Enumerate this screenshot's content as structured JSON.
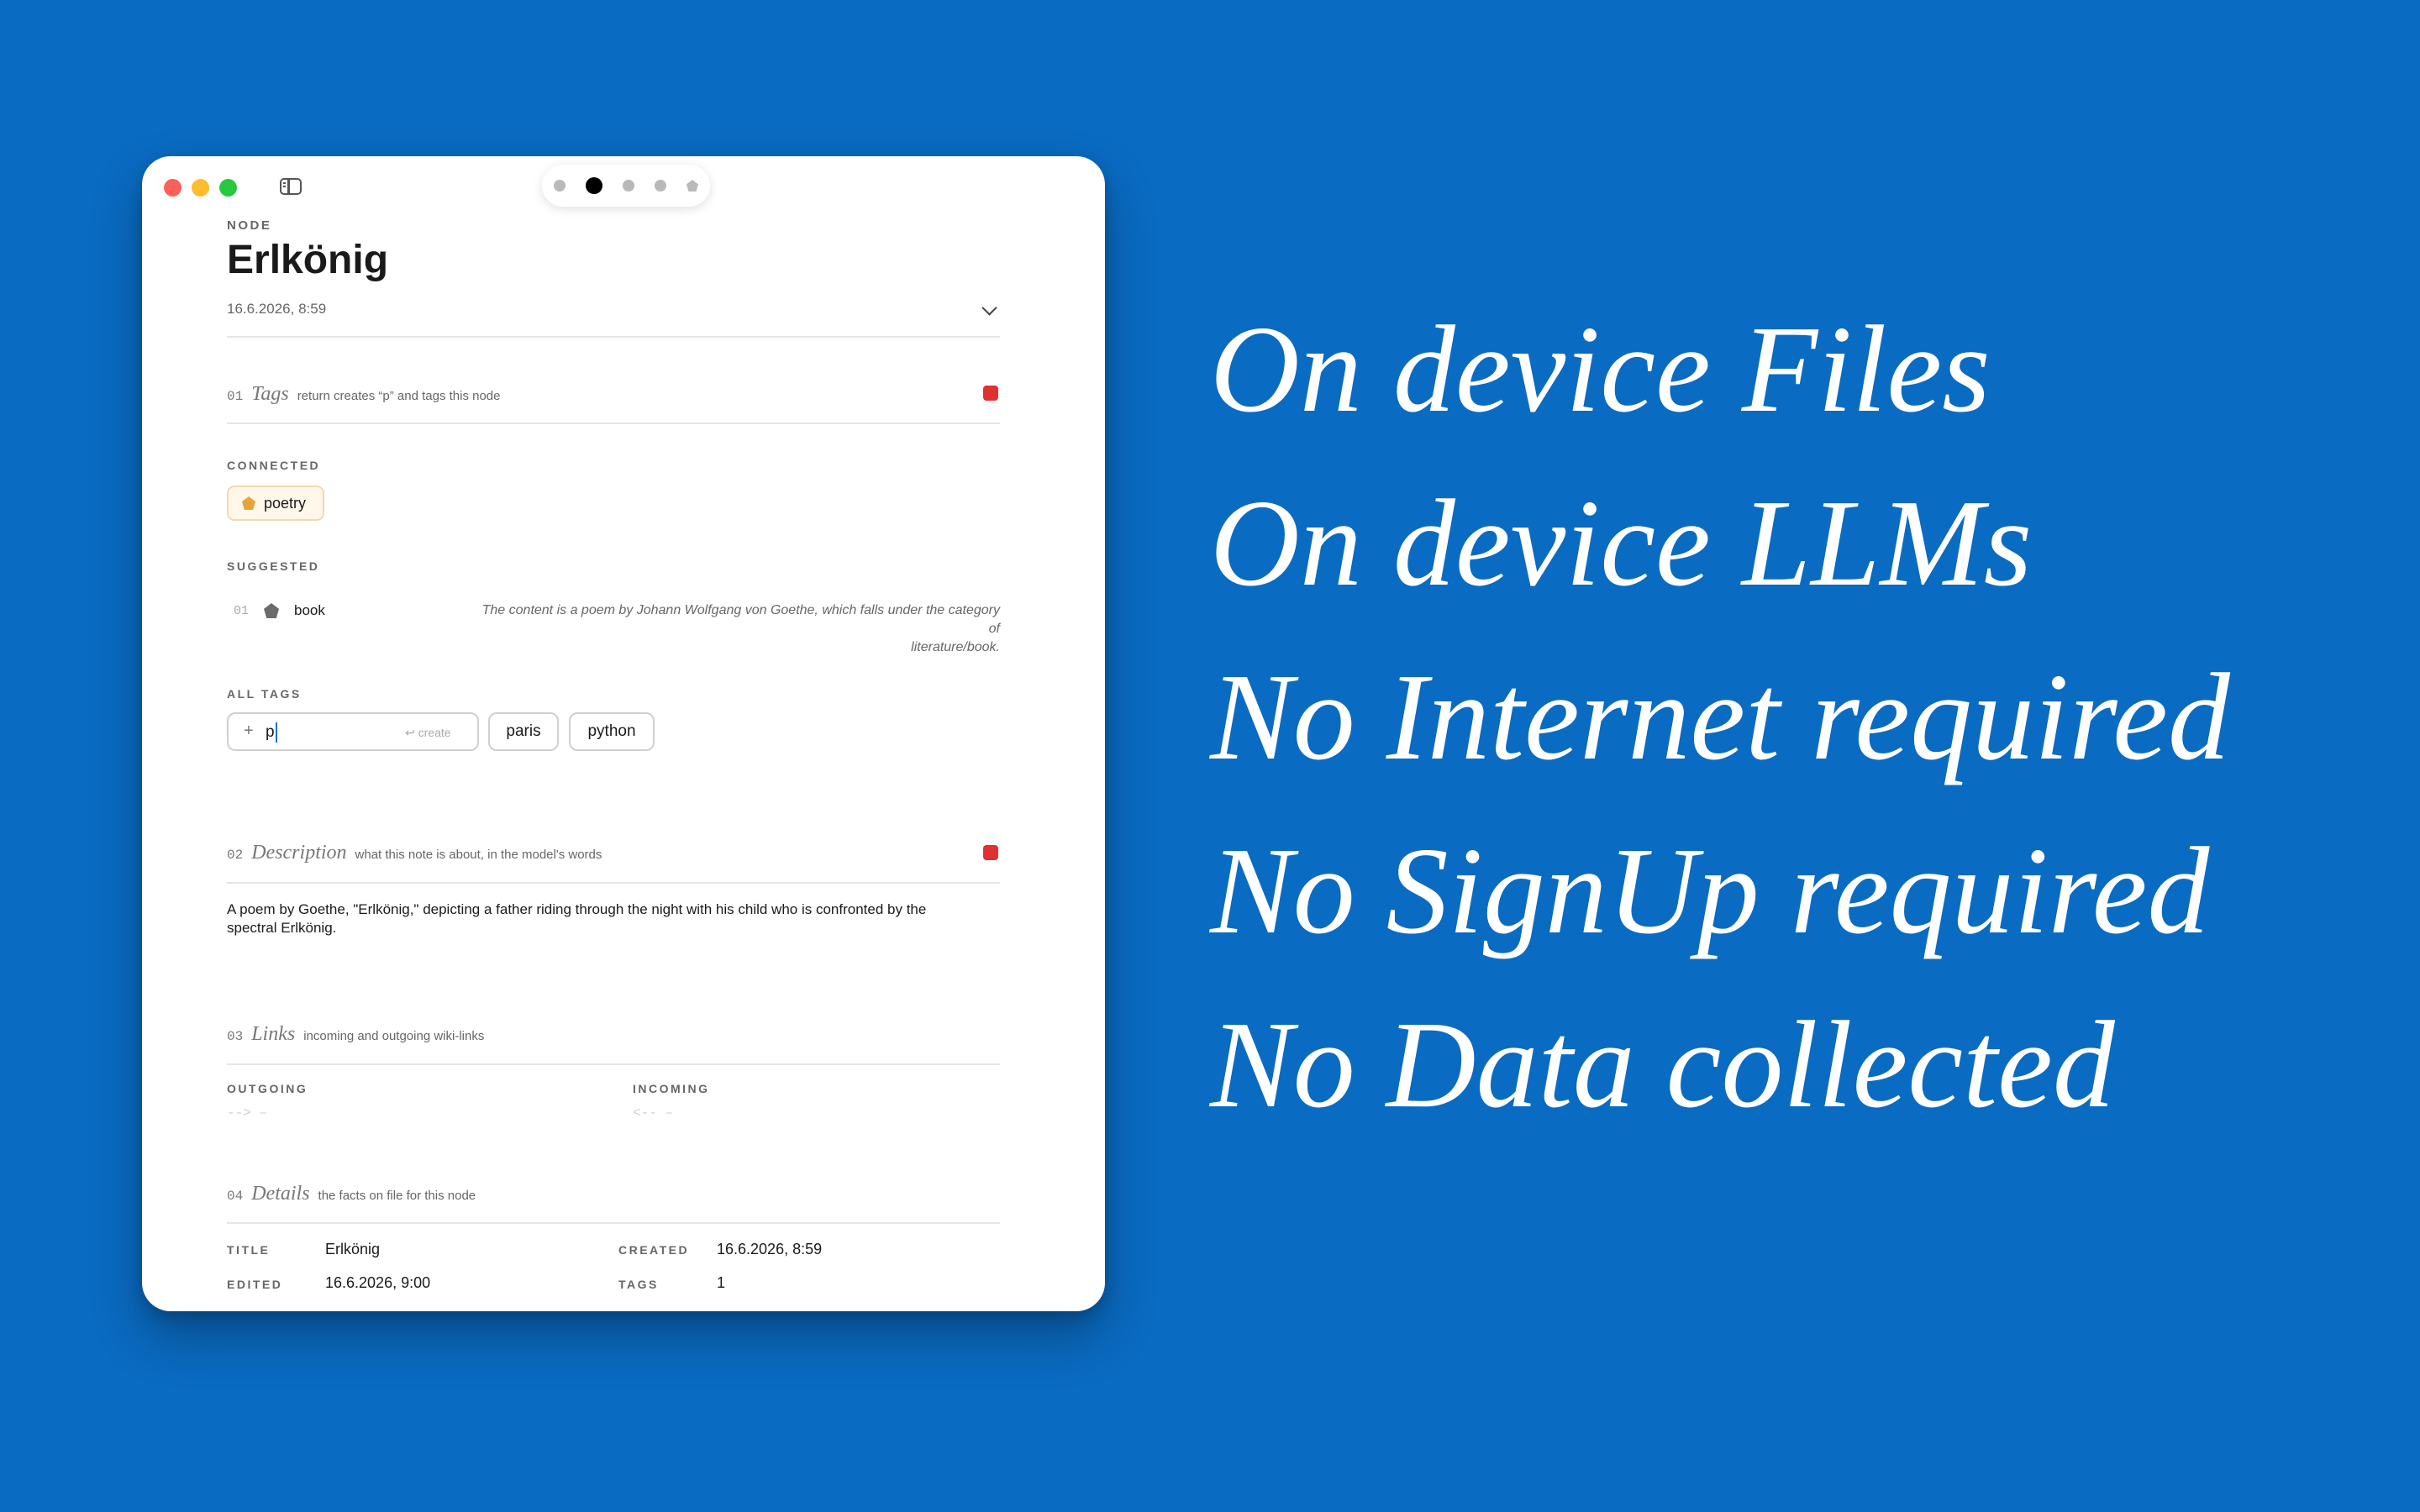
{
  "node": {
    "kind_label": "NODE",
    "title": "Erlkönig",
    "timestamp": "16.6.2026, 8:59"
  },
  "tags_section": {
    "number": "01",
    "name": "Tags",
    "hint": "return creates “p” and tags this node",
    "connected_label": "CONNECTED",
    "connected": [
      {
        "label": "poetry",
        "color": "#e8a33a"
      }
    ],
    "suggested_label": "SUGGESTED",
    "suggested": [
      {
        "index": "01",
        "label": "book",
        "icon_color": "#6b6b6b",
        "reason_line1": "The content is a poem by Johann Wolfgang von Goethe, which falls under the category of",
        "reason_line2": "literature/book."
      }
    ],
    "all_tags_label": "ALL TAGS",
    "input_prefix": "+",
    "input_value": "p",
    "input_action": "↩ create",
    "all_tags": [
      "paris",
      "python"
    ]
  },
  "description_section": {
    "number": "02",
    "name": "Description",
    "hint": "what this note is about, in the model's words",
    "text_line1": "A poem by Goethe, \"Erlkönig,\" depicting a father riding through the night with his child who is confronted by the",
    "text_line2": "spectral Erlkönig."
  },
  "links_section": {
    "number": "03",
    "name": "Links",
    "hint": "incoming and outgoing wiki-links",
    "outgoing_label": "OUTGOING",
    "outgoing_value": "--> –",
    "incoming_label": "INCOMING",
    "incoming_value": "<-- –"
  },
  "details_section": {
    "number": "04",
    "name": "Details",
    "hint": "the facts on file for this node",
    "title_label": "TITLE",
    "title_value": "Erlkönig",
    "created_label": "CREATED",
    "created_value": "16.6.2026, 8:59",
    "edited_label": "EDITED",
    "edited_value": "16.6.2026, 9:00",
    "tags_label": "TAGS",
    "tags_value": "1"
  },
  "taglines": [
    "On device Files",
    "On device LLMs",
    "No Internet required",
    "No SignUp required",
    "No Data collected"
  ],
  "colors": {
    "background": "#0a6bc2",
    "accent_red": "#e03131",
    "poetry_tag": "#e8a33a"
  },
  "icons": {
    "window_close": "traffic-red",
    "window_minimize": "traffic-yellow",
    "window_zoom": "traffic-green",
    "sidebar": "sidebar-toggle-icon",
    "collapse": "chevron-down-icon"
  }
}
